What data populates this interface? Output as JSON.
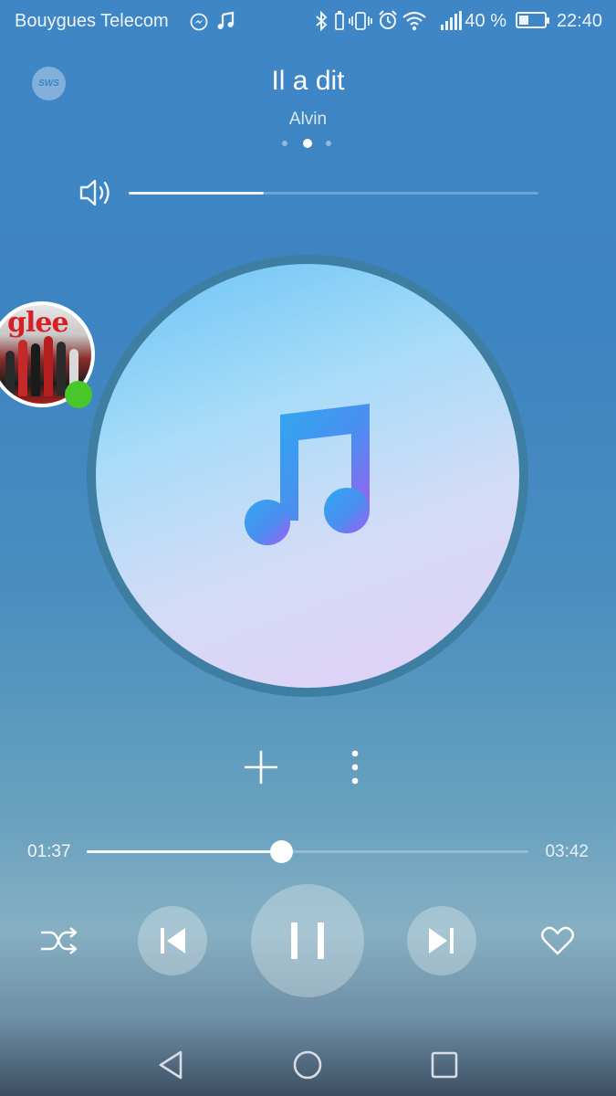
{
  "status_bar": {
    "carrier": "Bouygues Telecom",
    "battery_percent": "40 %",
    "time": "22:40",
    "icons": [
      "messenger-icon",
      "music-note-icon",
      "bluetooth-icon",
      "vibrate-icon",
      "alarm-icon",
      "wifi-icon",
      "signal-icon",
      "battery-icon"
    ]
  },
  "header": {
    "logo_text": "SWS",
    "song_title": "Il a dit",
    "artist": "Alvin",
    "page_dots": 3,
    "active_page": 2
  },
  "volume": {
    "level": 0.33
  },
  "thumbnail": {
    "label": "glee"
  },
  "player": {
    "current_time": "01:37",
    "total_time": "03:42",
    "progress": 0.44,
    "state": "playing"
  },
  "colors": {
    "background_top": "#3f86c6",
    "disk_ring": "#3f7ea3",
    "online_indicator": "#49c629",
    "note_gradient_start": "#2fa8ef",
    "note_gradient_end": "#a35cf3"
  }
}
